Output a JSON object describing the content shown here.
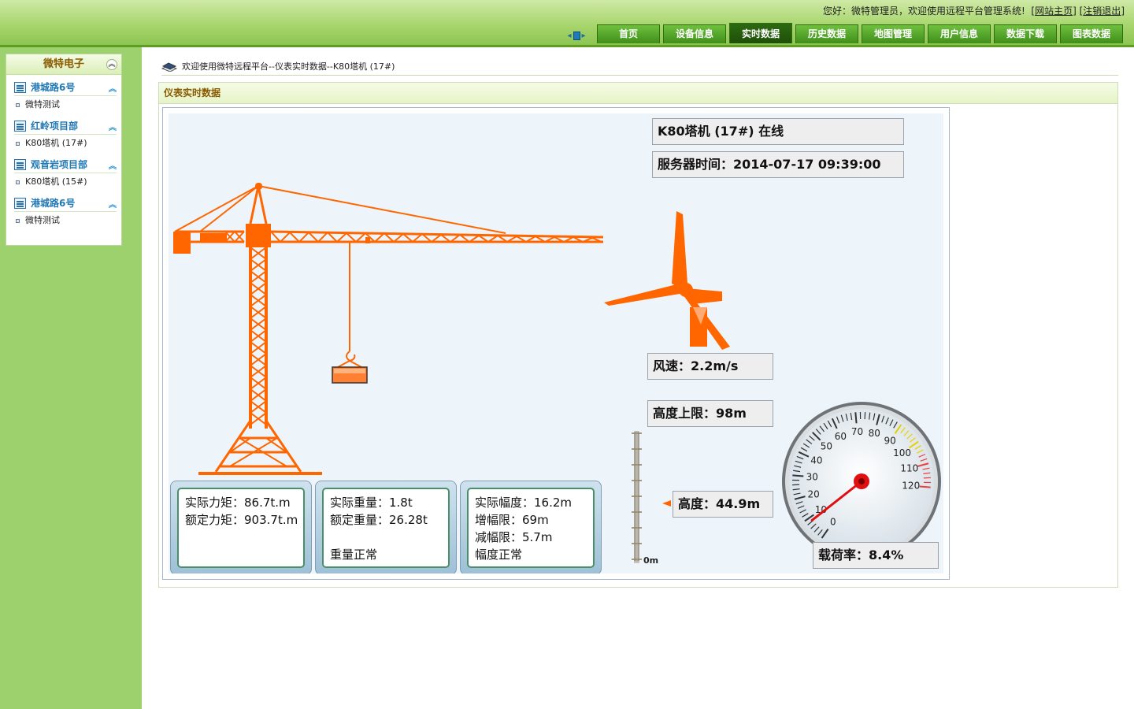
{
  "header": {
    "welcome_text": "您好：微特管理员，欢迎使用远程平台管理系统!",
    "home_link": "网站主页",
    "logout_link": "注销退出",
    "tabs": [
      "首页",
      "设备信息",
      "实时数据",
      "历史数据",
      "地图管理",
      "用户信息",
      "数据下载",
      "图表数据"
    ],
    "active_tab": "实时数据"
  },
  "sidebar": {
    "title": "微特电子",
    "groups": [
      {
        "label": "港城路6号",
        "items": [
          "微特测试"
        ]
      },
      {
        "label": "红岭项目部",
        "items": [
          "K80塔机 (17#)"
        ]
      },
      {
        "label": "观音岩项目部",
        "items": [
          "K80塔机 (15#)"
        ]
      },
      {
        "label": "港城路6号",
        "items": [
          "微特测试"
        ]
      }
    ]
  },
  "breadcrumb": "欢迎使用微特远程平台--仪表实时数据--K80塔机 (17#)",
  "panel_title": "仪表实时数据",
  "monitor": {
    "status": "K80塔机 (17#) 在线",
    "server_time": "服务器时间：2014-07-17 09:39:00",
    "wind_speed": "风速：2.2m/s",
    "height_limit": "高度上限：98m",
    "height": "高度：44.9m",
    "height_scale_zero": "0m",
    "load_rate": "载荷率：8.4%",
    "load_rate_value": 8.4,
    "gauge_ticks": [
      "0",
      "10",
      "20",
      "30",
      "40",
      "50",
      "60",
      "70",
      "80",
      "90",
      "100",
      "110",
      "120"
    ],
    "torque_card": {
      "actual": "实际力矩：86.7t.m",
      "rated": "额定力矩：903.7t.m"
    },
    "weight_card": {
      "actual": "实际重量：1.8t",
      "rated": "额定重量：26.28t",
      "status": "重量正常"
    },
    "range_card": {
      "actual": "实际幅度：16.2m",
      "increase_limit": "增幅限：69m",
      "decrease_limit": "减幅限：5.7m",
      "status": "幅度正常"
    }
  },
  "colors": {
    "crane": "#ff6600",
    "header_green": "#8cc552",
    "sidebar_green": "#9dd16e",
    "active_tab": "#2d6a11"
  }
}
